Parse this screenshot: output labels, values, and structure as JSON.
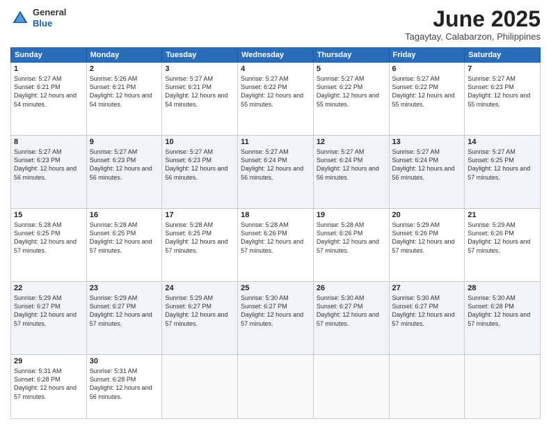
{
  "header": {
    "logo_general": "General",
    "logo_blue": "Blue",
    "month_title": "June 2025",
    "location": "Tagaytay, Calabarzon, Philippines"
  },
  "weekdays": [
    "Sunday",
    "Monday",
    "Tuesday",
    "Wednesday",
    "Thursday",
    "Friday",
    "Saturday"
  ],
  "weeks": [
    [
      {
        "day": "1",
        "sunrise": "5:27 AM",
        "sunset": "6:21 PM",
        "daylight": "12 hours and 54 minutes."
      },
      {
        "day": "2",
        "sunrise": "5:26 AM",
        "sunset": "6:21 PM",
        "daylight": "12 hours and 54 minutes."
      },
      {
        "day": "3",
        "sunrise": "5:27 AM",
        "sunset": "6:21 PM",
        "daylight": "12 hours and 54 minutes."
      },
      {
        "day": "4",
        "sunrise": "5:27 AM",
        "sunset": "6:22 PM",
        "daylight": "12 hours and 55 minutes."
      },
      {
        "day": "5",
        "sunrise": "5:27 AM",
        "sunset": "6:22 PM",
        "daylight": "12 hours and 55 minutes."
      },
      {
        "day": "6",
        "sunrise": "5:27 AM",
        "sunset": "6:22 PM",
        "daylight": "12 hours and 55 minutes."
      },
      {
        "day": "7",
        "sunrise": "5:27 AM",
        "sunset": "6:23 PM",
        "daylight": "12 hours and 55 minutes."
      }
    ],
    [
      {
        "day": "8",
        "sunrise": "5:27 AM",
        "sunset": "6:23 PM",
        "daylight": "12 hours and 56 minutes."
      },
      {
        "day": "9",
        "sunrise": "5:27 AM",
        "sunset": "6:23 PM",
        "daylight": "12 hours and 56 minutes."
      },
      {
        "day": "10",
        "sunrise": "5:27 AM",
        "sunset": "6:23 PM",
        "daylight": "12 hours and 56 minutes."
      },
      {
        "day": "11",
        "sunrise": "5:27 AM",
        "sunset": "6:24 PM",
        "daylight": "12 hours and 56 minutes."
      },
      {
        "day": "12",
        "sunrise": "5:27 AM",
        "sunset": "6:24 PM",
        "daylight": "12 hours and 56 minutes."
      },
      {
        "day": "13",
        "sunrise": "5:27 AM",
        "sunset": "6:24 PM",
        "daylight": "12 hours and 56 minutes."
      },
      {
        "day": "14",
        "sunrise": "5:27 AM",
        "sunset": "6:25 PM",
        "daylight": "12 hours and 57 minutes."
      }
    ],
    [
      {
        "day": "15",
        "sunrise": "5:28 AM",
        "sunset": "6:25 PM",
        "daylight": "12 hours and 57 minutes."
      },
      {
        "day": "16",
        "sunrise": "5:28 AM",
        "sunset": "6:25 PM",
        "daylight": "12 hours and 57 minutes."
      },
      {
        "day": "17",
        "sunrise": "5:28 AM",
        "sunset": "6:25 PM",
        "daylight": "12 hours and 57 minutes."
      },
      {
        "day": "18",
        "sunrise": "5:28 AM",
        "sunset": "6:26 PM",
        "daylight": "12 hours and 57 minutes."
      },
      {
        "day": "19",
        "sunrise": "5:28 AM",
        "sunset": "6:26 PM",
        "daylight": "12 hours and 57 minutes."
      },
      {
        "day": "20",
        "sunrise": "5:29 AM",
        "sunset": "6:26 PM",
        "daylight": "12 hours and 57 minutes."
      },
      {
        "day": "21",
        "sunrise": "5:29 AM",
        "sunset": "6:26 PM",
        "daylight": "12 hours and 57 minutes."
      }
    ],
    [
      {
        "day": "22",
        "sunrise": "5:29 AM",
        "sunset": "6:27 PM",
        "daylight": "12 hours and 57 minutes."
      },
      {
        "day": "23",
        "sunrise": "5:29 AM",
        "sunset": "6:27 PM",
        "daylight": "12 hours and 57 minutes."
      },
      {
        "day": "24",
        "sunrise": "5:29 AM",
        "sunset": "6:27 PM",
        "daylight": "12 hours and 57 minutes."
      },
      {
        "day": "25",
        "sunrise": "5:30 AM",
        "sunset": "6:27 PM",
        "daylight": "12 hours and 57 minutes."
      },
      {
        "day": "26",
        "sunrise": "5:30 AM",
        "sunset": "6:27 PM",
        "daylight": "12 hours and 57 minutes."
      },
      {
        "day": "27",
        "sunrise": "5:30 AM",
        "sunset": "6:27 PM",
        "daylight": "12 hours and 57 minutes."
      },
      {
        "day": "28",
        "sunrise": "5:30 AM",
        "sunset": "6:28 PM",
        "daylight": "12 hours and 57 minutes."
      }
    ],
    [
      {
        "day": "29",
        "sunrise": "5:31 AM",
        "sunset": "6:28 PM",
        "daylight": "12 hours and 57 minutes."
      },
      {
        "day": "30",
        "sunrise": "5:31 AM",
        "sunset": "6:28 PM",
        "daylight": "12 hours and 56 minutes."
      },
      null,
      null,
      null,
      null,
      null
    ]
  ]
}
